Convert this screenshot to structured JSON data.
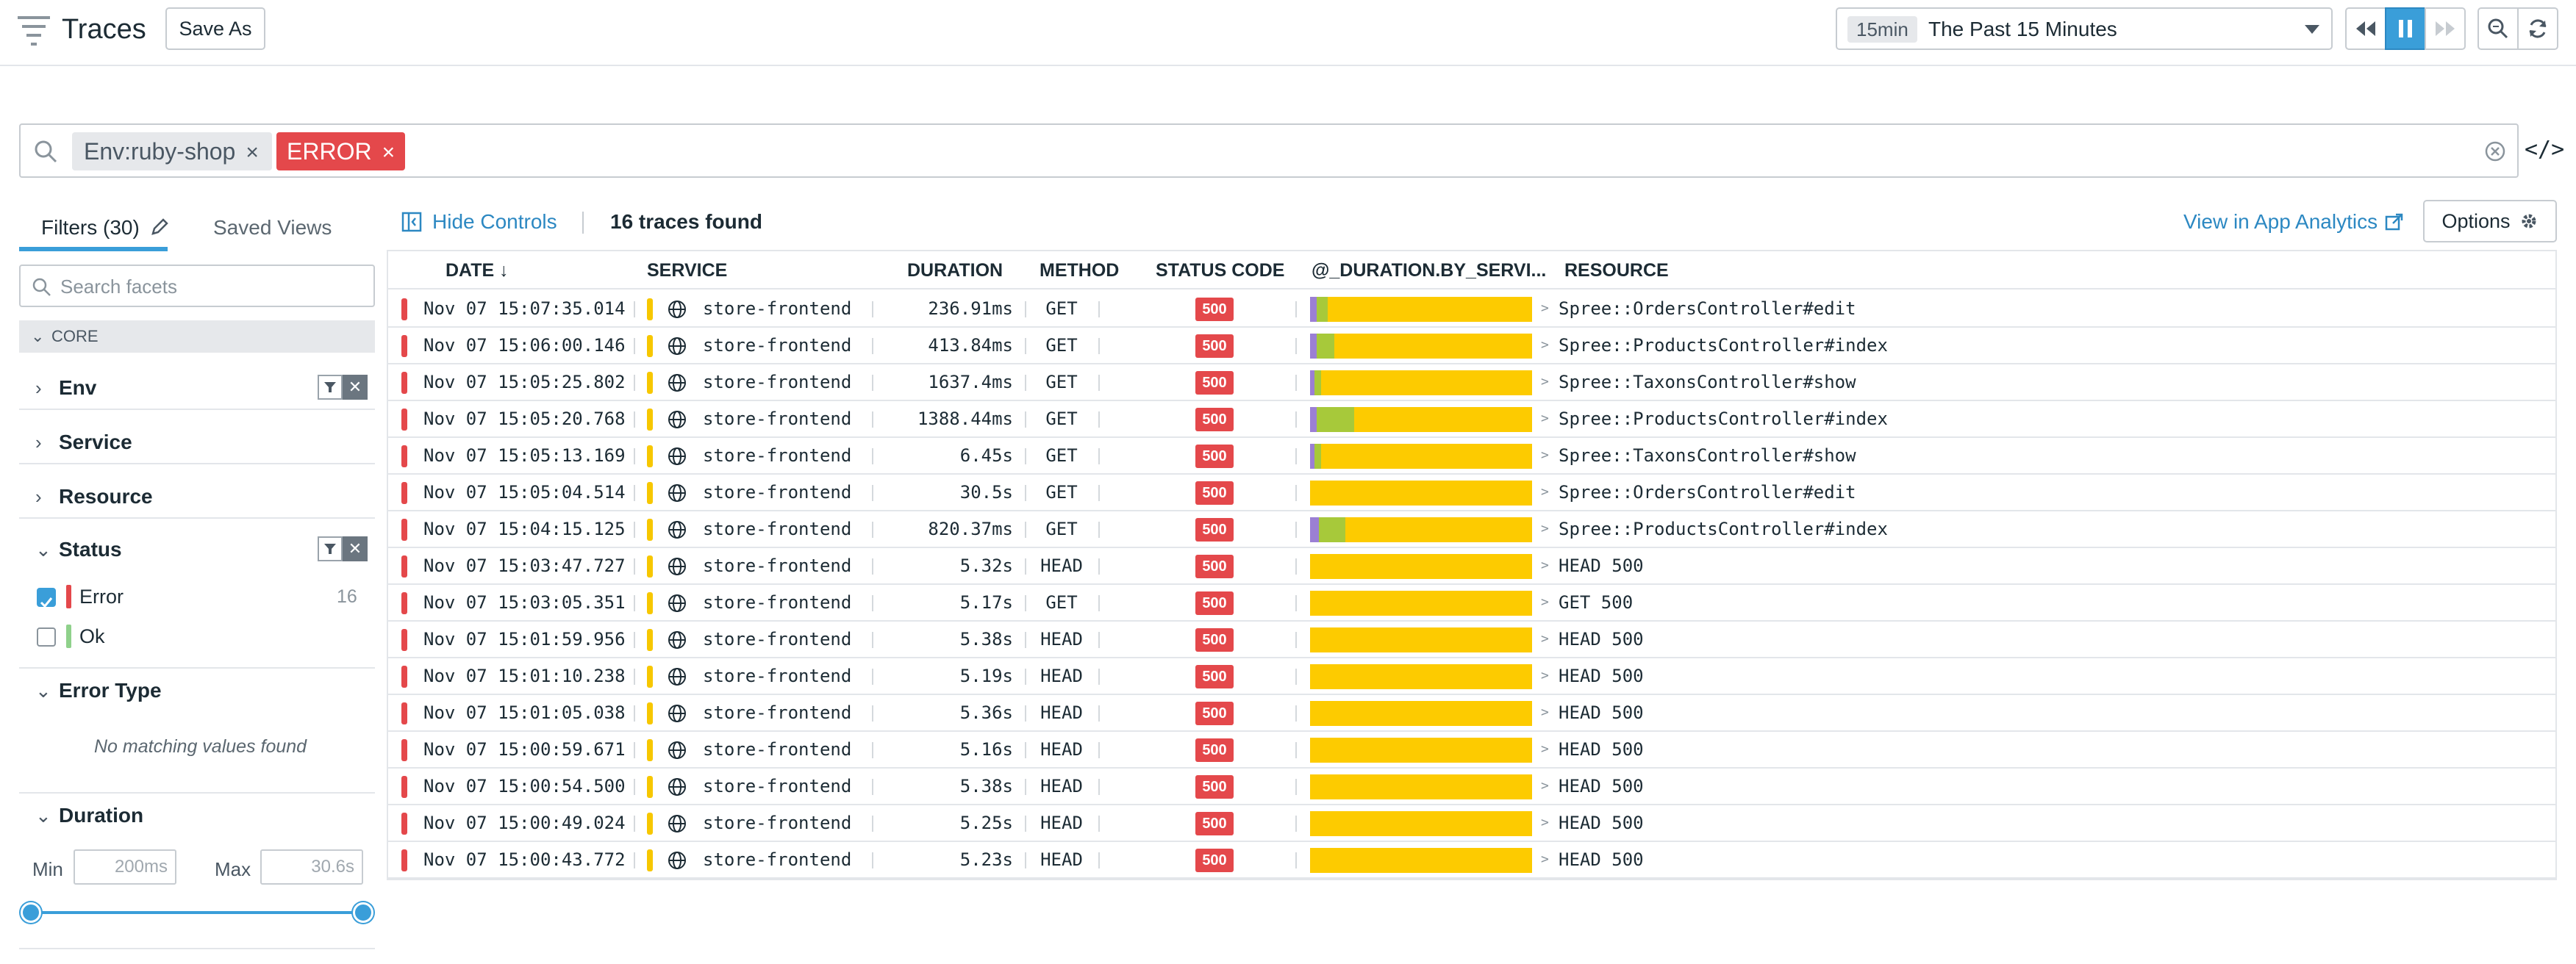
{
  "header": {
    "title": "Traces",
    "save_as": "Save As",
    "time_chip": "15min",
    "time_label": "The Past 15 Minutes"
  },
  "search": {
    "chips": [
      "Env:ruby-shop",
      "ERROR"
    ],
    "chip_close": "×"
  },
  "code_toggle": "</>",
  "left_panel": {
    "tabs": [
      "Filters (30)",
      "Saved Views"
    ],
    "facet_search_placeholder": "Search facets",
    "core_label": "CORE",
    "facets": {
      "env": "Env",
      "service": "Service",
      "resource": "Resource",
      "status": "Status",
      "error_type": "Error Type",
      "duration": "Duration"
    },
    "status_options": [
      {
        "label": "Error",
        "count": "16",
        "checked": true,
        "color": "#e4484b"
      },
      {
        "label": "Ok",
        "count": "",
        "checked": false,
        "color": "#8fd18b"
      }
    ],
    "error_type_empty": "No matching values found",
    "duration": {
      "min_label": "Min",
      "min_value": "200ms",
      "max_label": "Max",
      "max_value": "30.6s"
    }
  },
  "main": {
    "hide_controls": "Hide Controls",
    "traces_found": "16 traces found",
    "view_analytics": "View in App Analytics",
    "options": "Options"
  },
  "table": {
    "headers": {
      "date": "DATE ↓",
      "service": "SERVICE",
      "duration": "DURATION",
      "method": "METHOD",
      "status_code": "STATUS CODE",
      "duration_by_service": "@_DURATION.BY_SERVI...",
      "resource": "RESOURCE"
    },
    "rows": [
      {
        "date": "Nov 07 15:07:35.014",
        "service": "store-frontend",
        "duration": "236.91ms",
        "method": "GET",
        "status": "500",
        "resource": "Spree::OrdersController#edit",
        "bar": [
          0.03,
          0.05,
          0.92
        ]
      },
      {
        "date": "Nov 07 15:06:00.146",
        "service": "store-frontend",
        "duration": "413.84ms",
        "method": "GET",
        "status": "500",
        "resource": "Spree::ProductsController#index",
        "bar": [
          0.03,
          0.08,
          0.89
        ]
      },
      {
        "date": "Nov 07 15:05:25.802",
        "service": "store-frontend",
        "duration": "1637.4ms",
        "method": "GET",
        "status": "500",
        "resource": "Spree::TaxonsController#show",
        "bar": [
          0.02,
          0.03,
          0.95
        ]
      },
      {
        "date": "Nov 07 15:05:20.768",
        "service": "store-frontend",
        "duration": "1388.44ms",
        "method": "GET",
        "status": "500",
        "resource": "Spree::ProductsController#index",
        "bar": [
          0.03,
          0.17,
          0.8
        ]
      },
      {
        "date": "Nov 07 15:05:13.169",
        "service": "store-frontend",
        "duration": "6.45s",
        "method": "GET",
        "status": "500",
        "resource": "Spree::TaxonsController#show",
        "bar": [
          0.02,
          0.03,
          0.95
        ]
      },
      {
        "date": "Nov 07 15:05:04.514",
        "service": "store-frontend",
        "duration": "30.5s",
        "method": "GET",
        "status": "500",
        "resource": "Spree::OrdersController#edit",
        "bar": [
          0.0,
          0.0,
          1.0
        ]
      },
      {
        "date": "Nov 07 15:04:15.125",
        "service": "store-frontend",
        "duration": "820.37ms",
        "method": "GET",
        "status": "500",
        "resource": "Spree::ProductsController#index",
        "bar": [
          0.04,
          0.12,
          0.84
        ]
      },
      {
        "date": "Nov 07 15:03:47.727",
        "service": "store-frontend",
        "duration": "5.32s",
        "method": "HEAD",
        "status": "500",
        "resource": "HEAD 500",
        "bar": [
          0.0,
          0.0,
          1.0
        ]
      },
      {
        "date": "Nov 07 15:03:05.351",
        "service": "store-frontend",
        "duration": "5.17s",
        "method": "GET",
        "status": "500",
        "resource": "GET 500",
        "bar": [
          0.0,
          0.0,
          1.0
        ]
      },
      {
        "date": "Nov 07 15:01:59.956",
        "service": "store-frontend",
        "duration": "5.38s",
        "method": "HEAD",
        "status": "500",
        "resource": "HEAD 500",
        "bar": [
          0.0,
          0.0,
          1.0
        ]
      },
      {
        "date": "Nov 07 15:01:10.238",
        "service": "store-frontend",
        "duration": "5.19s",
        "method": "HEAD",
        "status": "500",
        "resource": "HEAD 500",
        "bar": [
          0.0,
          0.0,
          1.0
        ]
      },
      {
        "date": "Nov 07 15:01:05.038",
        "service": "store-frontend",
        "duration": "5.36s",
        "method": "HEAD",
        "status": "500",
        "resource": "HEAD 500",
        "bar": [
          0.0,
          0.0,
          1.0
        ]
      },
      {
        "date": "Nov 07 15:00:59.671",
        "service": "store-frontend",
        "duration": "5.16s",
        "method": "HEAD",
        "status": "500",
        "resource": "HEAD 500",
        "bar": [
          0.0,
          0.0,
          1.0
        ]
      },
      {
        "date": "Nov 07 15:00:54.500",
        "service": "store-frontend",
        "duration": "5.38s",
        "method": "HEAD",
        "status": "500",
        "resource": "HEAD 500",
        "bar": [
          0.0,
          0.0,
          1.0
        ]
      },
      {
        "date": "Nov 07 15:00:49.024",
        "service": "store-frontend",
        "duration": "5.25s",
        "method": "HEAD",
        "status": "500",
        "resource": "HEAD 500",
        "bar": [
          0.0,
          0.0,
          1.0
        ]
      },
      {
        "date": "Nov 07 15:00:43.772",
        "service": "store-frontend",
        "duration": "5.23s",
        "method": "HEAD",
        "status": "500",
        "resource": "HEAD 500",
        "bar": [
          0.0,
          0.0,
          1.0
        ]
      }
    ]
  },
  "colors": {
    "accent": "#3a9ed9",
    "error": "#e4484b",
    "ok": "#8fd18b",
    "service": "#f7c700",
    "bar_segments": [
      "#9b7fd4",
      "#a7c93a",
      "#fdcb00"
    ]
  }
}
